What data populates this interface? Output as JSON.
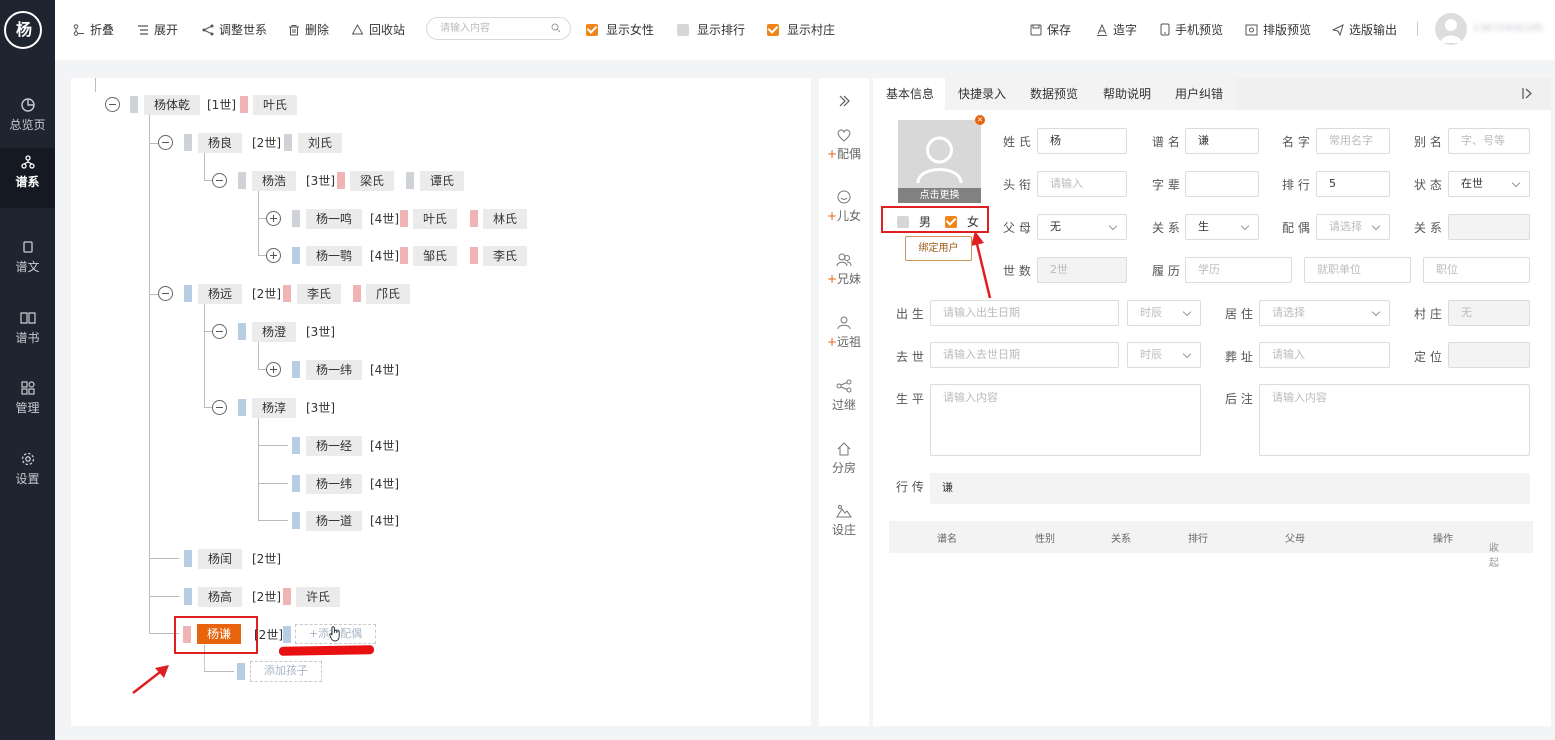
{
  "app": {
    "logo_text": "杨"
  },
  "sidebar": {
    "items": [
      {
        "label": "总览页",
        "icon": "pie-chart-icon"
      },
      {
        "label": "谱系",
        "icon": "tree-structure-icon"
      },
      {
        "label": "谱文",
        "icon": "document-icon"
      },
      {
        "label": "谱书",
        "icon": "book-icon"
      },
      {
        "label": "管理",
        "icon": "grid-icon"
      },
      {
        "label": "设置",
        "icon": "gear-icon"
      }
    ],
    "active": "谱系"
  },
  "toolbar": {
    "collapse": "折叠",
    "expand": "展开",
    "adjust": "调整世系",
    "delete": "删除",
    "recycle": "回收站",
    "search_placeholder": "请输入内容",
    "show_female": "显示女性",
    "show_rank": "显示排行",
    "show_village": "显示村庄",
    "show_female_checked": true,
    "show_rank_checked": false,
    "show_village_checked": true,
    "save": "保存",
    "make_char": "造字",
    "mobile_preview": "手机预览",
    "layout_preview": "排版预览",
    "export": "选版输出",
    "user_phone": "13672456185"
  },
  "tree": {
    "nodes": [
      {
        "name": "杨体乾",
        "gen": "[1世]",
        "spouses": [
          "叶氏"
        ]
      },
      {
        "name": "杨良",
        "gen": "[2世]",
        "spouses": [
          "刘氏"
        ]
      },
      {
        "name": "杨浩",
        "gen": "[3世]",
        "spouses": [
          "梁氏",
          "谭氏"
        ]
      },
      {
        "name": "杨一鸣",
        "gen": "[4世]",
        "spouses": [
          "叶氏",
          "林氏"
        ]
      },
      {
        "name": "杨一鹗",
        "gen": "[4世]",
        "spouses": [
          "邹氏",
          "李氏"
        ]
      },
      {
        "name": "杨远",
        "gen": "[2世]",
        "spouses": [
          "李氏",
          "邝氏"
        ]
      },
      {
        "name": "杨澄",
        "gen": "[3世]",
        "spouses": []
      },
      {
        "name": "杨一纬",
        "gen": "[4世]",
        "spouses": []
      },
      {
        "name": "杨淳",
        "gen": "[3世]",
        "spouses": []
      },
      {
        "name": "杨一经",
        "gen": "[4世]",
        "spouses": []
      },
      {
        "name": "杨一纬",
        "gen": "[4世]",
        "spouses": []
      },
      {
        "name": "杨一道",
        "gen": "[4世]",
        "spouses": []
      },
      {
        "name": "杨闰",
        "gen": "[2世]",
        "spouses": []
      },
      {
        "name": "杨高",
        "gen": "[2世]",
        "spouses": [
          "许氏"
        ]
      },
      {
        "name": "杨谦",
        "gen": "[2世]",
        "spouses": []
      }
    ],
    "add_spouse": "+添加配偶",
    "add_child": "添加孩子"
  },
  "midtools": {
    "items": [
      "配偶",
      "儿女",
      "兄妹",
      "远祖",
      "过继",
      "分房",
      "设庄"
    ],
    "plus": "+"
  },
  "form": {
    "tabs": [
      "基本信息",
      "快捷录入",
      "数据预览",
      "帮助说明",
      "用户纠错"
    ],
    "photo_change": "点击更换",
    "gender_male": "男",
    "gender_female": "女",
    "male_checked": false,
    "female_checked": true,
    "bind_user": "绑定用户",
    "surname_label": "姓 氏",
    "surname": "杨",
    "puming_label": "谱 名",
    "puming": "谦",
    "name_label": "名 字",
    "name_placeholder": "常用名字",
    "alias_label": "别 名",
    "alias_placeholder": "字、号等",
    "title_label": "头 衔",
    "title_placeholder": "请输入",
    "zibei_label": "字 辈",
    "zibei": "",
    "rank_label": "排 行",
    "rank": "5",
    "status_label": "状 态",
    "status": "在世",
    "parent_label": "父 母",
    "parent": "无",
    "relation_label": "关 系",
    "relation": "生",
    "spouse_label": "配 偶",
    "spouse_placeholder": "请选择",
    "relation2_label": "关 系",
    "relation2": "",
    "gen_label": "世 数",
    "gen_value": "2世",
    "resume_label": "履 历",
    "edu_placeholder": "学历",
    "work_placeholder": "就职单位",
    "job_placeholder": "职位",
    "birth_label": "出 生",
    "birth_placeholder": "请输入出生日期",
    "time_placeholder": "时辰",
    "live_label": "居 住",
    "live_placeholder": "请选择",
    "village_label": "村 庄",
    "village": "无",
    "death_label": "去 世",
    "death_placeholder": "请输入去世日期",
    "time2_placeholder": "时辰",
    "burial_label": "葬 址",
    "burial_placeholder": "请输入",
    "locate_label": "定 位",
    "locate": "",
    "bio_label": "生 平",
    "bio_placeholder": "请输入内容",
    "note_label": "后 注",
    "note_placeholder": "请输入内容",
    "xingchuan_label": "行 传",
    "xingchuan": "谦",
    "table_headers": [
      "谱名",
      "性别",
      "关系",
      "排行",
      "父母",
      "操作"
    ],
    "collapse": "收起"
  }
}
